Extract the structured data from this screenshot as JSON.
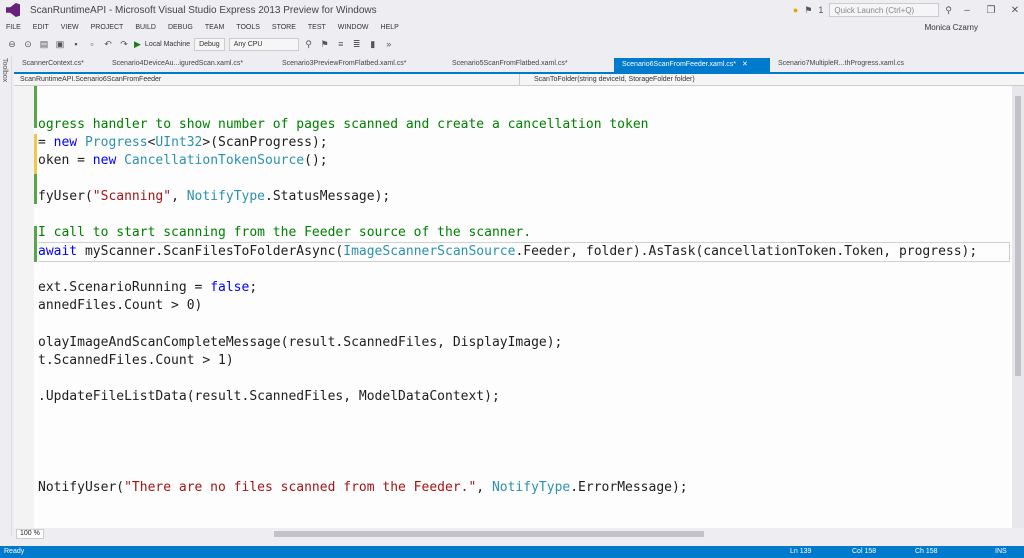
{
  "window": {
    "title": "ScanRuntimeAPI - Microsoft Visual Studio Express 2013 Preview for Windows",
    "quick_launch_placeholder": "Quick Launch (Ctrl+Q)",
    "notifications": "1",
    "min": "–",
    "max": "❐",
    "close": "✕"
  },
  "menu": {
    "items": [
      "FILE",
      "EDIT",
      "VIEW",
      "PROJECT",
      "BUILD",
      "DEBUG",
      "TEAM",
      "TOOLS",
      "STORE",
      "TEST",
      "WINDOW",
      "HELP"
    ],
    "user": "Monica Czarny"
  },
  "toolbar": {
    "run_target": "Local Machine",
    "config": "Debug",
    "platform": "Any CPU"
  },
  "sidetab": {
    "label": "Toolbox"
  },
  "tabs": [
    {
      "label": "ScannerContext.cs*"
    },
    {
      "label": "Scenario4DeviceAu...iguredScan.xaml.cs*"
    },
    {
      "label": "Scenario3PreviewFromFlatbed.xaml.cs*"
    },
    {
      "label": "Scenario5ScanFromFlatbed.xaml.cs*"
    },
    {
      "label": "Scenario6ScanFromFeeder.xaml.cs*",
      "close": "✕"
    },
    {
      "label": "Scenario7MultipleR...thProgress.xaml.cs"
    }
  ],
  "navbar": {
    "class_path": "ScanRuntimeAPI.Scenario6ScanFromFeeder",
    "member": "ScanToFolder(string deviceId, StorageFolder folder)"
  },
  "code": {
    "l1": "ogress handler to show number of pages scanned and create a cancellation token",
    "l2_a": "= ",
    "l2_kw": "new",
    "l2_sp": " ",
    "l2_ty": "Progress",
    "l2_b": "<",
    "l2_ty2": "UInt32",
    "l2_c": ">(ScanProgress);",
    "l3_a": "oken = ",
    "l3_kw": "new",
    "l3_sp": " ",
    "l3_ty": "CancellationTokenSource",
    "l3_b": "();",
    "l4_a": "fyUser(",
    "l4_str": "\"Scanning\"",
    "l4_b": ", ",
    "l4_ty": "NotifyType",
    "l4_c": ".StatusMessage);",
    "l5": "I call to start scanning from the Feeder source of the scanner.",
    "l6_kw": "await",
    "l6_a": " myScanner.ScanFilesToFolderAsync(",
    "l6_ty": "ImageScannerScanSource",
    "l6_b": ".Feeder, folder).AsTask(cancellationToken.Token, progress);",
    "l7_a": "ext.ScenarioRunning = ",
    "l7_kw": "false",
    "l7_b": ";",
    "l8": "annedFiles.Count > 0)",
    "l9": "olayImageAndScanCompleteMessage(result.ScannedFiles, DisplayImage);",
    "l10": "t.ScannedFiles.Count > 1)",
    "l11": ".UpdateFileListData(result.ScannedFiles, ModelDataContext);",
    "l12_a": "NotifyUser(",
    "l12_str": "\"There are no files scanned from the Feeder.\"",
    "l12_b": ", ",
    "l12_ty": "NotifyType",
    "l12_c": ".ErrorMessage);"
  },
  "editor": {
    "zoom": "100 %"
  },
  "status": {
    "state": "Ready",
    "line": "Ln 139",
    "col": "Col 158",
    "ch": "Ch 158",
    "mode": "INS"
  }
}
